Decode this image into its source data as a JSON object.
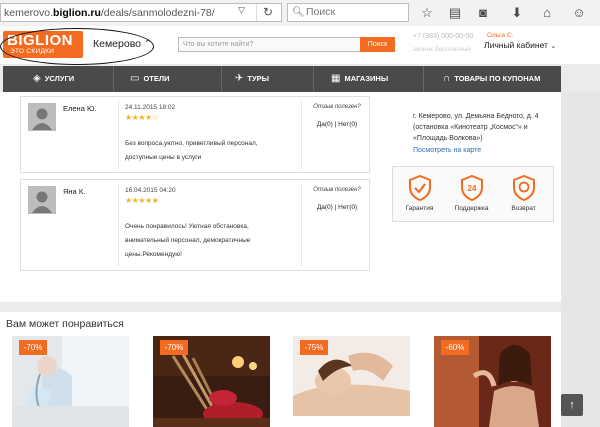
{
  "browser": {
    "url_prefix": "kemerovo.",
    "url_domain": "biglion.ru",
    "url_path": "/deals/sanmolodezni-78/",
    "dropdown_icon": "chevron-down-icon",
    "reload_icon": "reload-icon",
    "search_placeholder": "Поиск"
  },
  "site": {
    "logo_text": "BIGLION",
    "logo_tagline": "ЭТО СКИДКИ",
    "city": "Кемерово",
    "search_placeholder": "Что вы хотите найти?",
    "search_button": "Поиск",
    "phone": "+7 (383) 000-00-00",
    "phone_note": "звонок бесплатный",
    "user_name": "Ольга С.",
    "cabinet_label": "Личный кабинет"
  },
  "nav": [
    {
      "label": "УСЛУГИ",
      "icon": "tag-icon"
    },
    {
      "label": "ОТЕЛИ",
      "icon": "bed-icon"
    },
    {
      "label": "ТУРЫ",
      "icon": "plane-icon"
    },
    {
      "label": "МАГАЗИНЫ",
      "icon": "shop-icon"
    },
    {
      "label": "ТОВАРЫ ПО КУПОНАМ",
      "icon": "headphones-icon"
    }
  ],
  "reviews": [
    {
      "name": "Елена Ю.",
      "date": "24.11.2015 18:02",
      "stars": "★★★★☆",
      "rating": 4,
      "lines": [
        "Без вопроса,уютно, приветливый персонал,",
        "доступные цены в услуги"
      ],
      "useful_label": "Отзыв полезен?",
      "useful_votes": "Да(0) | Нет(0)"
    },
    {
      "name": "Яна К.",
      "date": "16.04.2015 04:20",
      "stars": "★★★★★",
      "rating": 5,
      "lines": [
        "Очень понравилось! Уютная обстановка,",
        "внимательный персонал, демократичные",
        "цены.Рекомендую!"
      ],
      "useful_label": "Отзыв полезен?",
      "useful_votes": "Да(0) | Нет(0)"
    }
  ],
  "address": {
    "text": "г. Кемерово, ул. Демьяна Бедного, д. 4 (остановка «Кинотеатр „Космос“» и «Площадь Волкова»)",
    "map_link": "Посмотреть на карте"
  },
  "guarantees": [
    {
      "label": "Гарантия",
      "icon": "shield-check-icon"
    },
    {
      "label": "Поддержка",
      "icon": "support-24-icon"
    },
    {
      "label": "Возврат",
      "icon": "refund-icon"
    }
  ],
  "recommendations": {
    "title": "Вам может понравиться",
    "items": [
      {
        "discount": "-70%"
      },
      {
        "discount": "-70%"
      },
      {
        "discount": "-75%"
      },
      {
        "discount": "-60%"
      }
    ]
  },
  "colors": {
    "accent": "#f26b21",
    "nav_bg": "#4a4a4a",
    "star": "#f0b41f"
  }
}
